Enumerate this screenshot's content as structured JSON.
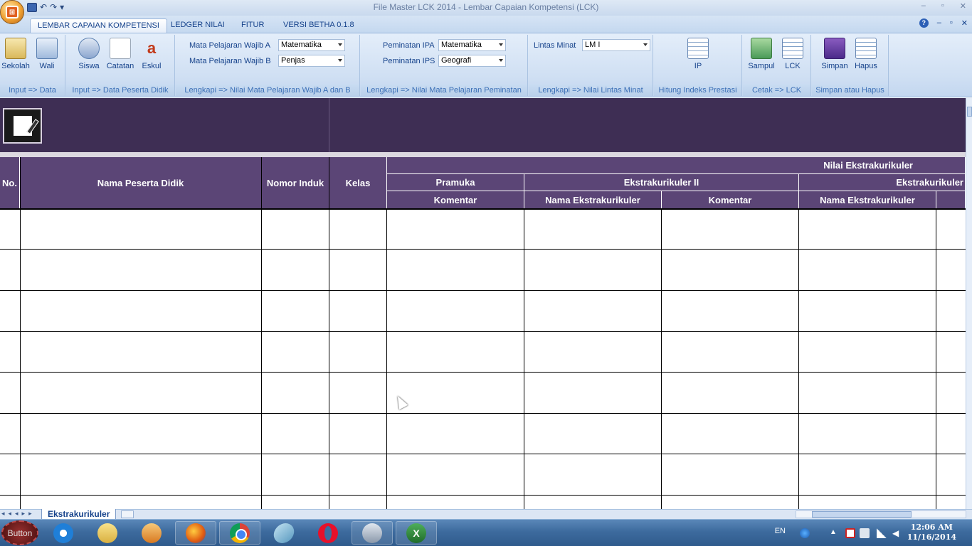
{
  "window": {
    "title": "File Master LCK 2014  -  Lembar Capaian Kompetensi (LCK)",
    "minimize": "–",
    "restore": "▫",
    "close": "✕"
  },
  "tabs": [
    {
      "label": "LEMBAR CAPAIAN KOMPETENSI"
    },
    {
      "label": "LEDGER NILAI"
    },
    {
      "label": "FITUR"
    },
    {
      "label": "VERSI BETHA 0.1.8"
    }
  ],
  "ribbon": {
    "groups": [
      {
        "label": "Input => Data",
        "buttons": [
          {
            "label": "Sekolah"
          },
          {
            "label": "Wali"
          }
        ]
      },
      {
        "label": "Input => Data Peserta Didik",
        "buttons": [
          {
            "label": "Siswa"
          },
          {
            "label": "Catatan"
          },
          {
            "label": "Eskul"
          }
        ]
      },
      {
        "label": "Lengkapi => Nilai Mata Pelajaran Wajib A dan B"
      },
      {
        "label": "Lengkapi => Nilai Mata Pelajaran Peminatan"
      },
      {
        "label": "Lengkapi => Nilai Lintas Minat"
      },
      {
        "label": "Hitung Indeks Prestasi",
        "buttons": [
          {
            "label": "IP"
          }
        ]
      },
      {
        "label": "Cetak => LCK",
        "buttons": [
          {
            "label": "Sampul"
          },
          {
            "label": "LCK"
          }
        ]
      },
      {
        "label": "Simpan atau Hapus",
        "buttons": [
          {
            "label": "Simpan"
          },
          {
            "label": "Hapus"
          }
        ]
      }
    ],
    "fields": {
      "wajib_a_label": "Mata Pelajaran Wajib A",
      "wajib_a_value": "Matematika",
      "wajib_b_label": "Mata Pelajaran Wajib B",
      "wajib_b_value": "Penjas",
      "ipa_label": "Peminatan IPA",
      "ipa_value": "Matematika",
      "ips_label": "Peminatan IPS",
      "ips_value": "Geografi",
      "lintas_label": "Lintas Minat",
      "lintas_value": "LM I"
    }
  },
  "table": {
    "headers": {
      "no": "No.",
      "nama": "Nama Peserta Didik",
      "nomor_induk": "Nomor Induk",
      "kelas": "Kelas",
      "nilai_ekstra": "Nilai Ekstrakurikuler",
      "pramuka": "Pramuka",
      "ekstra2": "Ekstrakurikuler II",
      "ekstra3": "Ekstrakurikuler",
      "komentar1": "Komentar",
      "nama_ekstra2": "Nama Ekstrakurikuler",
      "komentar2": "Komentar",
      "nama_ekstra3": "Nama Ekstrakurikuler"
    }
  },
  "sheet_tabs": [
    {
      "label": "Ekstrakurikuler"
    }
  ],
  "taskbar": {
    "start_label": "Button",
    "language": "EN",
    "time": "12:06 AM",
    "date": "11/16/2014"
  },
  "colors": {
    "header_purple": "#5b4576",
    "banner_purple": "#3e2e54",
    "ribbon_blue": "#cfdff3"
  }
}
